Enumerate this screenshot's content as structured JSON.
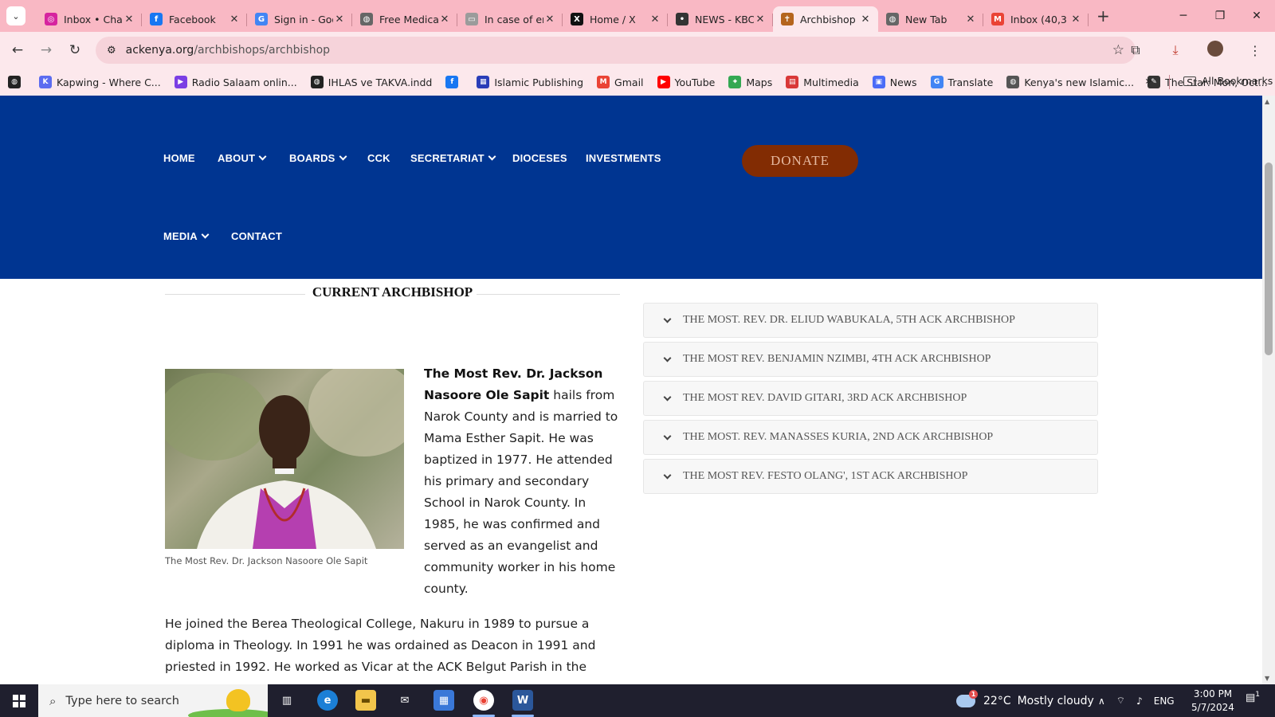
{
  "browser": {
    "tabs": [
      {
        "title": "Inbox • Chats",
        "icon": "instagram-icon",
        "color": "#d6249f",
        "glyph": "◎"
      },
      {
        "title": "Facebook",
        "icon": "facebook-icon",
        "color": "#1877f2",
        "glyph": "f"
      },
      {
        "title": "Sign in - Google",
        "icon": "google-icon",
        "color": "#4285f4",
        "glyph": "G"
      },
      {
        "title": "Free Medical",
        "icon": "globe-icon",
        "color": "#666666",
        "glyph": "◍"
      },
      {
        "title": "In case of emergency",
        "icon": "page-icon",
        "color": "#9b9b9b",
        "glyph": "▭"
      },
      {
        "title": "Home / X",
        "icon": "x-icon",
        "color": "#111111",
        "glyph": "X"
      },
      {
        "title": "NEWS - KBC",
        "icon": "kbc-icon",
        "color": "#333333",
        "glyph": "•"
      },
      {
        "title": "Archbishop",
        "icon": "ack-logo-icon",
        "color": "#b5651d",
        "glyph": "✝",
        "active": true
      },
      {
        "title": "New Tab",
        "icon": "globe-icon",
        "color": "#666666",
        "glyph": "◍"
      },
      {
        "title": "Inbox (40,3",
        "icon": "gmail-icon",
        "color": "#ea4335",
        "glyph": "M"
      }
    ],
    "url_host": "ackenya.org",
    "url_path": "/archbishops/archbishop",
    "bookmarks": [
      {
        "label": "",
        "icon": "globe-icon",
        "color": "#222222",
        "glyph": "◍"
      },
      {
        "label": "Kapwing - Where C...",
        "icon": "kapwing-icon",
        "color": "#5b6cf0",
        "glyph": "K"
      },
      {
        "label": "Radio Salaam onlin...",
        "icon": "radio-icon",
        "color": "#7b3fe4",
        "glyph": "▶"
      },
      {
        "label": "IHLAS ve TAKVA.indd",
        "icon": "globe-icon",
        "color": "#222222",
        "glyph": "◍"
      },
      {
        "label": "",
        "icon": "facebook-icon",
        "color": "#1877f2",
        "glyph": "f"
      },
      {
        "label": "Islamic Publishing",
        "icon": "publishing-icon",
        "color": "#2a3db8",
        "glyph": "▦"
      },
      {
        "label": "Gmail",
        "icon": "gmail-icon",
        "color": "#ea4335",
        "glyph": "M"
      },
      {
        "label": "YouTube",
        "icon": "youtube-icon",
        "color": "#ff0000",
        "glyph": "▶"
      },
      {
        "label": "Maps",
        "icon": "maps-icon",
        "color": "#34a853",
        "glyph": "⌖"
      },
      {
        "label": "Multimedia",
        "icon": "multimedia-icon",
        "color": "#d93838",
        "glyph": "▤"
      },
      {
        "label": "News",
        "icon": "news-icon",
        "color": "#4a6cf7",
        "glyph": "▣"
      },
      {
        "label": "Translate",
        "icon": "translate-icon",
        "color": "#4285f4",
        "glyph": "G"
      },
      {
        "label": "Kenya's new Islamic...",
        "icon": "globe-icon",
        "color": "#555555",
        "glyph": "◍"
      },
      {
        "label": "The Star: Mon, Oct...",
        "icon": "star-news-icon",
        "color": "#333333",
        "glyph": "✎"
      }
    ],
    "all_bookmarks": "All Bookmarks"
  },
  "site": {
    "menu": {
      "home": "HOME",
      "about": "ABOUT",
      "boards": "BOARDS",
      "cck": "CCK",
      "secretariat": "SECRETARIAT",
      "dioceses": "DIOCESES",
      "investments": "INVESTMENTS",
      "media": "MEDIA",
      "contact": "CONTACT"
    },
    "donate": "DONATE",
    "section_title": "CURRENT ARCHBISHOP",
    "photo_caption": "The Most Rev. Dr. Jackson Nasoore Ole Sapit",
    "bio_name": "The Most Rev. Dr. Jackson Nasoore Ole Sapit",
    "bio_text": " hails from Narok County and is married to Mama Esther Sapit. He was baptized in 1977. He attended his primary and secondary School in Narok County. In 1985, he was confirmed and served as an evangelist and community worker in his home county.",
    "bio_text_2": "He joined the Berea Theological College, Nakuru in 1989 to pursue a diploma in Theology. In 1991 he was ordained as Deacon in 1991 and priested in 1992. He worked as Vicar at the ACK Belgut Parish in the",
    "past_archbishops": [
      "THE MOST. REV. DR. ELIUD WABUKALA, 5TH ACK ARCHBISHOP",
      "THE MOST REV. BENJAMIN NZIMBI, 4TH ACK ARCHBISHOP",
      "THE MOST REV. DAVID GITARI, 3RD ACK ARCHBISHOP",
      "THE MOST. REV. MANASSES KURIA, 2ND ACK ARCHBISHOP",
      "THE MOST REV. FESTO OLANG', 1ST ACK ARCHBISHOP"
    ],
    "colors": {
      "header_bg": "#003591",
      "donate_bg": "#822c03"
    }
  },
  "taskbar": {
    "search_placeholder": "Type here to search",
    "weather_temp": "22°C",
    "weather_desc": "Mostly cloudy",
    "weather_badge": "1",
    "language": "ENG",
    "time": "3:00 PM",
    "date": "5/7/2024",
    "notification_count": "1"
  }
}
